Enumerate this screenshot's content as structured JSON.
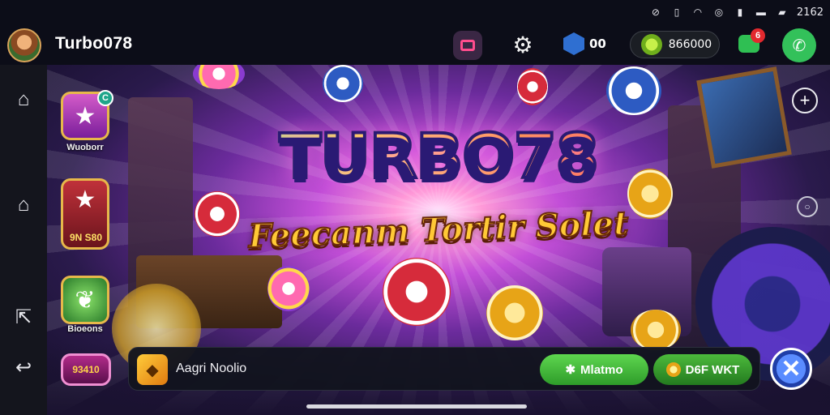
{
  "status_bar": {
    "time": "2162",
    "icons": [
      "dnd-icon",
      "sim-icon",
      "wifi-icon",
      "vpn-icon",
      "battery-saver-icon",
      "signal-icon",
      "battery-icon"
    ]
  },
  "header": {
    "app_title": "Turbo078",
    "gem_count": "00",
    "coin_balance": "866000",
    "message_badge": "6"
  },
  "banner": {
    "title": "TURBO78",
    "subtitle": "Feecanm Tortir Solet"
  },
  "side_games": [
    {
      "label": "Wuoborr",
      "badge": "C",
      "icon": "star-icon"
    },
    {
      "label": "",
      "price": "9N S80",
      "icon": "star-icon"
    },
    {
      "label": "Bioeons",
      "icon": "leaf-icon"
    },
    {
      "label": "",
      "value": "93410",
      "icon": "slot-icon"
    }
  ],
  "bottom_bar": {
    "text": "Aagri Noolio",
    "primary_button": "Mlatmo",
    "secondary_button": "D6F WKT"
  },
  "colors": {
    "accent_green": "#33c15a",
    "banner_purple": "#6b2b9c",
    "title_gold": "#ffd23a"
  }
}
